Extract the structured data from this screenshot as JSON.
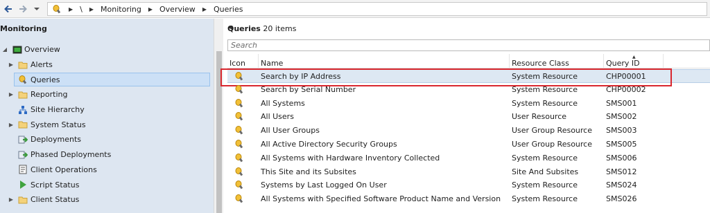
{
  "address": {
    "back_icon": "back-arrow-icon",
    "forward_icon": "forward-arrow-icon",
    "breadcrumbs": [
      "\\",
      "Monitoring",
      "Overview",
      "Queries"
    ]
  },
  "nav": {
    "title": "Monitoring",
    "items": [
      {
        "label": "Overview",
        "icon": "overview-icon",
        "expander": "expanded"
      },
      {
        "label": "Alerts",
        "icon": "folder-icon",
        "expander": "collapsed"
      },
      {
        "label": "Queries",
        "icon": "query-icon",
        "expander": "",
        "selected": true
      },
      {
        "label": "Reporting",
        "icon": "folder-icon",
        "expander": "collapsed"
      },
      {
        "label": "Site Hierarchy",
        "icon": "site-hierarchy-icon",
        "expander": ""
      },
      {
        "label": "System Status",
        "icon": "folder-icon",
        "expander": "collapsed"
      },
      {
        "label": "Deployments",
        "icon": "deployment-icon",
        "expander": ""
      },
      {
        "label": "Phased Deployments",
        "icon": "deployment-icon",
        "expander": ""
      },
      {
        "label": "Client Operations",
        "icon": "client-operations-icon",
        "expander": ""
      },
      {
        "label": "Script Status",
        "icon": "script-icon",
        "expander": ""
      },
      {
        "label": "Client Status",
        "icon": "folder-icon",
        "expander": "collapsed"
      }
    ]
  },
  "main": {
    "title": "Queries",
    "count": "20 items",
    "search_placeholder": "Search",
    "columns": [
      "Icon",
      "Name",
      "Resource Class",
      "Query ID"
    ],
    "rows": [
      {
        "name": "Search by IP Address",
        "resource_class": "System Resource",
        "query_id": "CHP00001"
      },
      {
        "name": "Search by Serial Number",
        "resource_class": "System Resource",
        "query_id": "CHP00002"
      },
      {
        "name": "All Systems",
        "resource_class": "System Resource",
        "query_id": "SMS001"
      },
      {
        "name": "All Users",
        "resource_class": "User Resource",
        "query_id": "SMS002"
      },
      {
        "name": "All User Groups",
        "resource_class": "User Group Resource",
        "query_id": "SMS003"
      },
      {
        "name": "All Active Directory Security Groups",
        "resource_class": "User Group Resource",
        "query_id": "SMS005"
      },
      {
        "name": "All Systems with Hardware Inventory Collected",
        "resource_class": "System Resource",
        "query_id": "SMS006"
      },
      {
        "name": "This Site and its Subsites",
        "resource_class": "Site And Subsites",
        "query_id": "SMS012"
      },
      {
        "name": "Systems by Last Logged On User",
        "resource_class": "System Resource",
        "query_id": "SMS024"
      },
      {
        "name": "All Systems with Specified Software Product Name and Version",
        "resource_class": "System Resource",
        "query_id": "SMS026"
      }
    ]
  },
  "colors": {
    "highlight_border": "#d9272e",
    "nav_bg": "#dde6f1",
    "selection": "#cce0f6"
  }
}
